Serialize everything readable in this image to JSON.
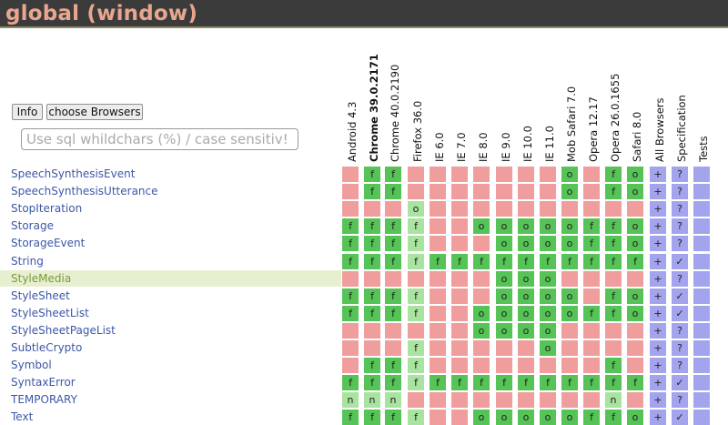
{
  "window": {
    "title": "global (window)"
  },
  "toolbar": {
    "info_label": "Info",
    "choose_browsers_label": "choose Browsers"
  },
  "search": {
    "placeholder": "Use sql whildchars (%) / case sensitiv!"
  },
  "columns": [
    {
      "label": "Android 4.3",
      "bold": false
    },
    {
      "label": "Chrome 39.0.2171",
      "bold": true
    },
    {
      "label": "Chrome 40.0.2190",
      "bold": false
    },
    {
      "label": "Firefox 36.0",
      "bold": false
    },
    {
      "label": "IE 6.0",
      "bold": false
    },
    {
      "label": "IE 7.0",
      "bold": false
    },
    {
      "label": "IE 8.0",
      "bold": false
    },
    {
      "label": "IE 9.0",
      "bold": false
    },
    {
      "label": "IE 10.0",
      "bold": false
    },
    {
      "label": "IE 11.0",
      "bold": false
    },
    {
      "label": "Mob Safari 7.0",
      "bold": false
    },
    {
      "label": "Opera 12.17",
      "bold": false
    },
    {
      "label": "Opera 26.0.1655",
      "bold": false
    },
    {
      "label": "Safari 8.0",
      "bold": false
    },
    {
      "label": "All Browsers",
      "bold": false
    },
    {
      "label": "Specification",
      "bold": false
    },
    {
      "label": "Tests",
      "bold": false
    }
  ],
  "rows": [
    {
      "name": "SpeechSynthesisEvent",
      "highlight": false,
      "cells": [
        "x",
        "f",
        "f",
        "x",
        "x",
        "x",
        "x",
        "x",
        "x",
        "x",
        "o",
        "x",
        "f",
        "o",
        "+",
        "?",
        ""
      ]
    },
    {
      "name": "SpeechSynthesisUtterance",
      "highlight": false,
      "cells": [
        "x",
        "f",
        "f",
        "x",
        "x",
        "x",
        "x",
        "x",
        "x",
        "x",
        "o",
        "x",
        "f",
        "o",
        "+",
        "?",
        ""
      ]
    },
    {
      "name": "StopIteration",
      "highlight": false,
      "cells": [
        "x",
        "x",
        "x",
        "o",
        "x",
        "x",
        "x",
        "x",
        "x",
        "x",
        "x",
        "x",
        "x",
        "x",
        "+",
        "?",
        ""
      ]
    },
    {
      "name": "Storage",
      "highlight": false,
      "cells": [
        "f",
        "f",
        "f",
        "f",
        "x",
        "x",
        "o",
        "o",
        "o",
        "o",
        "o",
        "f",
        "f",
        "o",
        "+",
        "?",
        ""
      ]
    },
    {
      "name": "StorageEvent",
      "highlight": false,
      "cells": [
        "f",
        "f",
        "f",
        "f",
        "x",
        "x",
        "x",
        "o",
        "o",
        "o",
        "o",
        "f",
        "f",
        "o",
        "+",
        "?",
        ""
      ]
    },
    {
      "name": "String",
      "highlight": false,
      "cells": [
        "f",
        "f",
        "f",
        "f",
        "f",
        "f",
        "f",
        "f",
        "f",
        "f",
        "f",
        "f",
        "f",
        "f",
        "+",
        "✓",
        ""
      ]
    },
    {
      "name": "StyleMedia",
      "highlight": true,
      "cells": [
        "x",
        "x",
        "x",
        "x",
        "x",
        "x",
        "x",
        "o",
        "o",
        "o",
        "x",
        "x",
        "x",
        "x",
        "+",
        "?",
        ""
      ]
    },
    {
      "name": "StyleSheet",
      "highlight": false,
      "cells": [
        "f",
        "f",
        "f",
        "f",
        "x",
        "x",
        "x",
        "o",
        "o",
        "o",
        "o",
        "x",
        "f",
        "o",
        "+",
        "✓",
        ""
      ]
    },
    {
      "name": "StyleSheetList",
      "highlight": false,
      "cells": [
        "f",
        "f",
        "f",
        "f",
        "x",
        "x",
        "o",
        "o",
        "o",
        "o",
        "o",
        "f",
        "f",
        "o",
        "+",
        "✓",
        ""
      ]
    },
    {
      "name": "StyleSheetPageList",
      "highlight": false,
      "cells": [
        "x",
        "x",
        "x",
        "x",
        "x",
        "x",
        "o",
        "o",
        "o",
        "o",
        "x",
        "x",
        "x",
        "x",
        "+",
        "?",
        ""
      ]
    },
    {
      "name": "SubtleCrypto",
      "highlight": false,
      "cells": [
        "x",
        "x",
        "x",
        "f",
        "x",
        "x",
        "x",
        "x",
        "x",
        "o",
        "x",
        "x",
        "x",
        "x",
        "+",
        "?",
        ""
      ]
    },
    {
      "name": "Symbol",
      "highlight": false,
      "cells": [
        "x",
        "f",
        "f",
        "f",
        "x",
        "x",
        "x",
        "x",
        "x",
        "x",
        "x",
        "x",
        "f",
        "x",
        "+",
        "?",
        ""
      ]
    },
    {
      "name": "SyntaxError",
      "highlight": false,
      "cells": [
        "f",
        "f",
        "f",
        "f",
        "f",
        "f",
        "f",
        "f",
        "f",
        "f",
        "f",
        "f",
        "f",
        "f",
        "+",
        "✓",
        ""
      ]
    },
    {
      "name": "TEMPORARY",
      "highlight": false,
      "cells": [
        "n",
        "n",
        "n",
        "x",
        "x",
        "x",
        "x",
        "x",
        "x",
        "x",
        "x",
        "x",
        "n",
        "x",
        "+",
        "?",
        ""
      ]
    },
    {
      "name": "Text",
      "highlight": false,
      "cells": [
        "f",
        "f",
        "f",
        "f",
        "x",
        "x",
        "o",
        "o",
        "o",
        "o",
        "o",
        "f",
        "f",
        "o",
        "+",
        "✓",
        ""
      ]
    }
  ],
  "colors": {
    "yes": "#56c356",
    "partial": "#a8e3a0",
    "no": "#ef9d9d",
    "meta": "#a4a4ee",
    "title": "#e9a68f"
  }
}
